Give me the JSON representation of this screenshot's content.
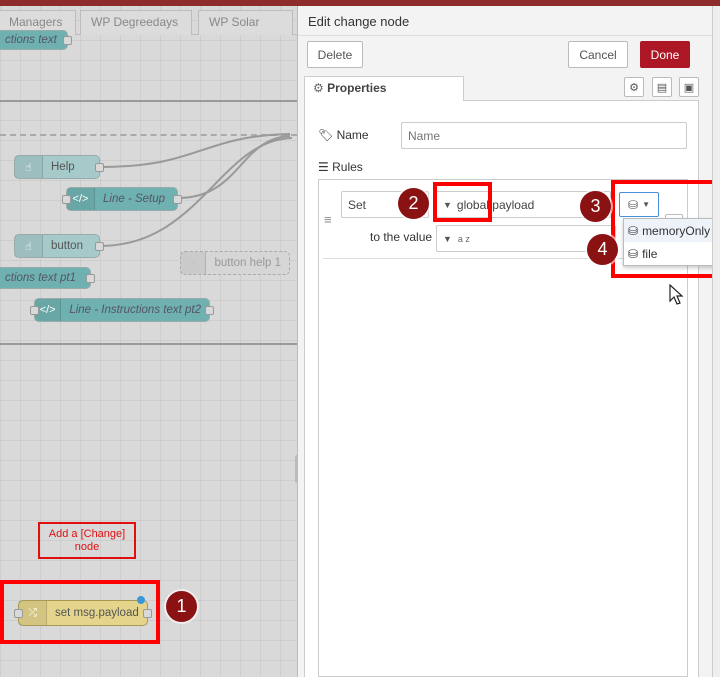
{
  "workspace": {
    "tabs": [
      "Managers",
      "WP Degreedays",
      "WP Solar"
    ],
    "nodes": {
      "instructions_text": "ctions text",
      "help": "Help",
      "line_setup": "Line - Setup",
      "button": "button",
      "button_help": "button help 1",
      "instructions_pt1": "ctions text pt1",
      "instructions_pt2": "Line - Instructions text pt2",
      "set_payload": "set msg.payload"
    },
    "annotation": "Add a [Change] node"
  },
  "markers": [
    "1",
    "2",
    "3",
    "4"
  ],
  "tray": {
    "title": "Edit change node",
    "delete_label": "Delete",
    "cancel_label": "Cancel",
    "done_label": "Done",
    "properties_tab": "Properties",
    "name_label": "Name",
    "name_placeholder": "Name",
    "rules_label": "Rules",
    "rule": {
      "action": "Set",
      "target_type": "global.",
      "target_value": "payload",
      "to_label": "to the value",
      "value_type": "a z"
    },
    "context_stores": [
      "memoryOnly",
      "file"
    ]
  },
  "colors": {
    "accent": "#ad1625",
    "highlight": "#ff0000",
    "marker": "#8a1212"
  }
}
